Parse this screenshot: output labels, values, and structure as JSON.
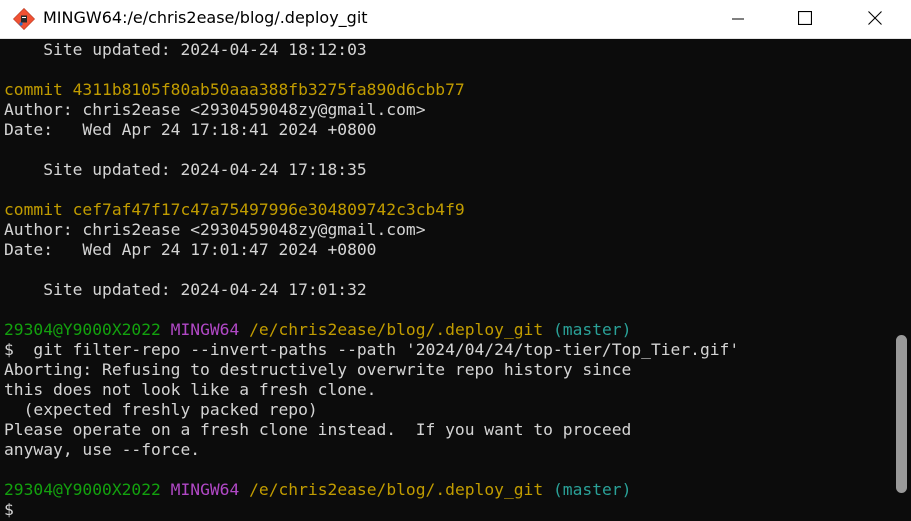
{
  "window": {
    "title": "MINGW64:/e/chris2ease/blog/.deploy_git",
    "icons": {
      "app": "git-bash-icon",
      "minimize": "minimize-icon",
      "maximize": "maximize-icon",
      "close": "close-icon"
    }
  },
  "terminal": {
    "colors": {
      "background": "#0c0c0c",
      "text": "#d4d4d4",
      "yellow": "#c19c00",
      "green": "#13a10e",
      "magenta": "#b148c6",
      "cyan": "#2aa198"
    },
    "lines": [
      {
        "segments": [
          {
            "text": "    Site updated: 2024-04-24 18:12:03",
            "color": "default"
          }
        ]
      },
      {
        "segments": []
      },
      {
        "segments": [
          {
            "text": "commit 4311b8105f80ab50aaa388fb3275fa890d6cbb77",
            "color": "yellow"
          }
        ]
      },
      {
        "segments": [
          {
            "text": "Author: chris2ease <2930459048zy@gmail.com>",
            "color": "default"
          }
        ]
      },
      {
        "segments": [
          {
            "text": "Date:   Wed Apr 24 17:18:41 2024 +0800",
            "color": "default"
          }
        ]
      },
      {
        "segments": []
      },
      {
        "segments": [
          {
            "text": "    Site updated: 2024-04-24 17:18:35",
            "color": "default"
          }
        ]
      },
      {
        "segments": []
      },
      {
        "segments": [
          {
            "text": "commit cef7af47f17c47a75497996e304809742c3cb4f9",
            "color": "yellow"
          }
        ]
      },
      {
        "segments": [
          {
            "text": "Author: chris2ease <2930459048zy@gmail.com>",
            "color": "default"
          }
        ]
      },
      {
        "segments": [
          {
            "text": "Date:   Wed Apr 24 17:01:47 2024 +0800",
            "color": "default"
          }
        ]
      },
      {
        "segments": []
      },
      {
        "segments": [
          {
            "text": "    Site updated: 2024-04-24 17:01:32",
            "color": "default"
          }
        ]
      },
      {
        "segments": []
      },
      {
        "segments": [
          {
            "text": "29304@Y9000X2022",
            "color": "green"
          },
          {
            "text": " ",
            "color": "default"
          },
          {
            "text": "MINGW64",
            "color": "magenta"
          },
          {
            "text": " ",
            "color": "default"
          },
          {
            "text": "/e/chris2ease/blog/.deploy_git",
            "color": "yellow"
          },
          {
            "text": " ",
            "color": "default"
          },
          {
            "text": "(master)",
            "color": "cyan"
          }
        ]
      },
      {
        "segments": [
          {
            "text": "$  git filter-repo --invert-paths --path '2024/04/24/top-tier/Top_Tier.gif'",
            "color": "default"
          }
        ]
      },
      {
        "segments": [
          {
            "text": "Aborting: Refusing to destructively overwrite repo history since",
            "color": "default"
          }
        ]
      },
      {
        "segments": [
          {
            "text": "this does not look like a fresh clone.",
            "color": "default"
          }
        ]
      },
      {
        "segments": [
          {
            "text": "  (expected freshly packed repo)",
            "color": "default"
          }
        ]
      },
      {
        "segments": [
          {
            "text": "Please operate on a fresh clone instead.  If you want to proceed",
            "color": "default"
          }
        ]
      },
      {
        "segments": [
          {
            "text": "anyway, use --force.",
            "color": "default"
          }
        ]
      },
      {
        "segments": []
      },
      {
        "segments": [
          {
            "text": "29304@Y9000X2022",
            "color": "green"
          },
          {
            "text": " ",
            "color": "default"
          },
          {
            "text": "MINGW64",
            "color": "magenta"
          },
          {
            "text": " ",
            "color": "default"
          },
          {
            "text": "/e/chris2ease/blog/.deploy_git",
            "color": "yellow"
          },
          {
            "text": " ",
            "color": "default"
          },
          {
            "text": "(master)",
            "color": "cyan"
          }
        ]
      },
      {
        "segments": [
          {
            "text": "$",
            "color": "default"
          }
        ]
      }
    ]
  }
}
